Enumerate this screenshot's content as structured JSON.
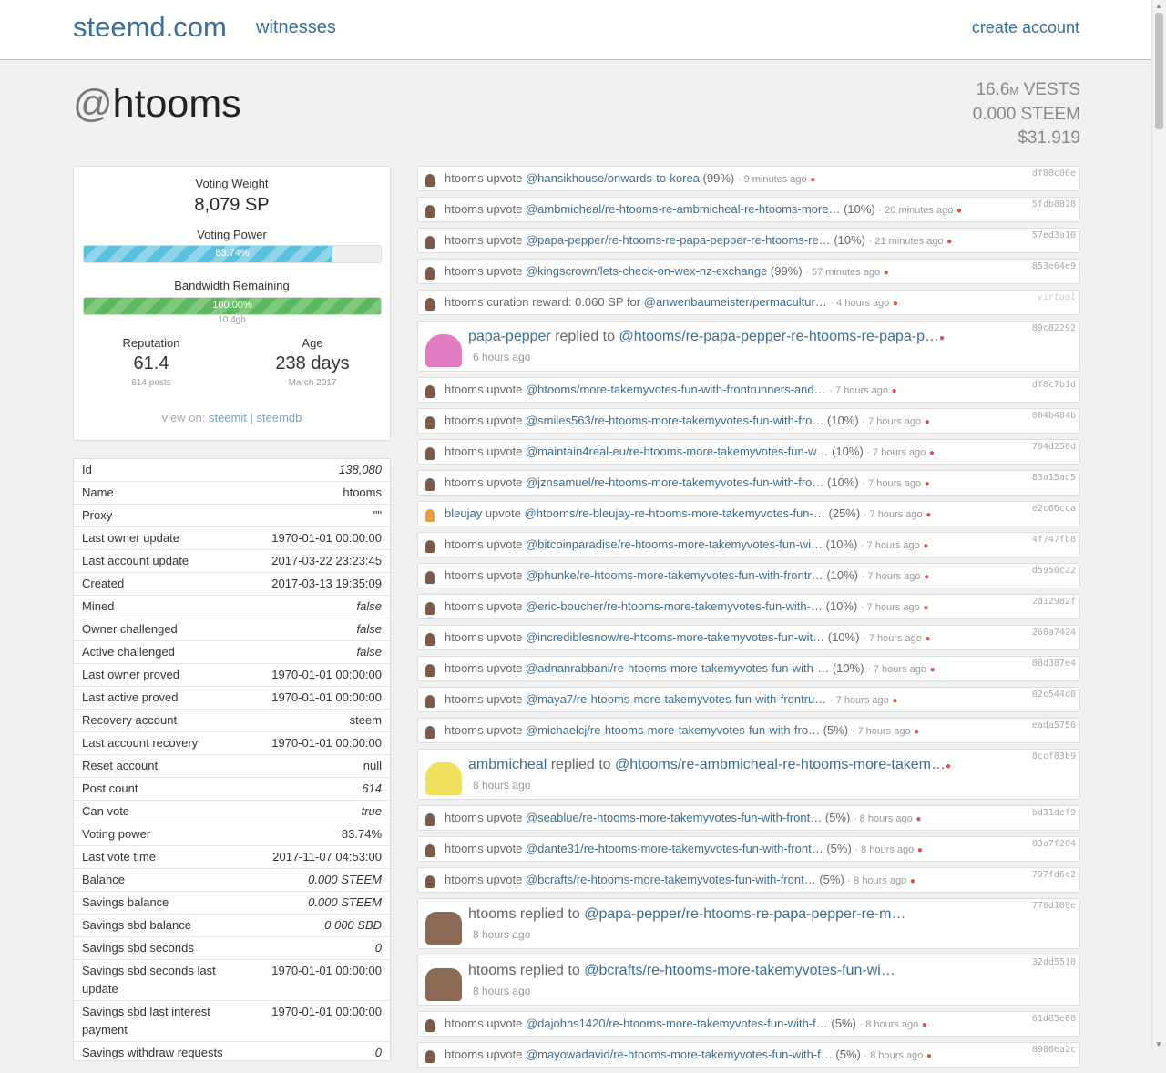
{
  "nav": {
    "brand": "steemd.com",
    "witnesses": "witnesses",
    "create": "create account"
  },
  "profile": {
    "at": "@",
    "name": "htooms"
  },
  "balances": {
    "vests_num": "16.6",
    "vests_unit": "M",
    "vests_label": " VESTS",
    "steem": "0.000 STEEM",
    "usd": "$31.919"
  },
  "stats": {
    "voting_weight_label": "Voting Weight",
    "voting_weight": "8,079 SP",
    "voting_power_label": "Voting Power",
    "voting_power_text": "83.74%",
    "voting_power_fraction": 0.8374,
    "bandwidth_label": "Bandwidth Remaining",
    "bandwidth_text": "100.00%",
    "bandwidth_fraction": 1.0,
    "bandwidth_size": "10.4gb",
    "reputation_label": "Reputation",
    "reputation": "61.4",
    "posts": "614 posts",
    "age_label": "Age",
    "age": "238 days",
    "age_since": "March 2017",
    "view_on": "view on:",
    "steemit": "steemit",
    "sep": "|",
    "steemdb": "steemdb"
  },
  "props": [
    {
      "k": "Id",
      "v": "138,080",
      "it": true
    },
    {
      "k": "Name",
      "v": "htooms",
      "it": false
    },
    {
      "k": "Proxy",
      "v": "\"\"",
      "it": false
    },
    {
      "k": "Last owner update",
      "v": "1970-01-01 00:00:00",
      "it": false
    },
    {
      "k": "Last account update",
      "v": "2017-03-22 23:23:45",
      "it": false
    },
    {
      "k": "Created",
      "v": "2017-03-13 19:35:09",
      "it": false
    },
    {
      "k": "Mined",
      "v": "false",
      "it": true
    },
    {
      "k": "Owner challenged",
      "v": "false",
      "it": true
    },
    {
      "k": "Active challenged",
      "v": "false",
      "it": true
    },
    {
      "k": "Last owner proved",
      "v": "1970-01-01 00:00:00",
      "it": false
    },
    {
      "k": "Last active proved",
      "v": "1970-01-01 00:00:00",
      "it": false
    },
    {
      "k": "Recovery account",
      "v": "steem",
      "it": false
    },
    {
      "k": "Last account recovery",
      "v": "1970-01-01 00:00:00",
      "it": false
    },
    {
      "k": "Reset account",
      "v": "null",
      "it": false
    },
    {
      "k": "Post count",
      "v": "614",
      "it": true
    },
    {
      "k": "Can vote",
      "v": "true",
      "it": true
    },
    {
      "k": "Voting power",
      "v": "83.74%",
      "it": false
    },
    {
      "k": "Last vote time",
      "v": "2017-11-07 04:53:00",
      "it": false
    },
    {
      "k": "Balance",
      "v": "0.000 STEEM",
      "it": true
    },
    {
      "k": "Savings balance",
      "v": "0.000 STEEM",
      "it": true
    },
    {
      "k": "Savings sbd balance",
      "v": "0.000 SBD",
      "it": true
    },
    {
      "k": "Savings sbd seconds",
      "v": "0",
      "it": true
    },
    {
      "k": "Savings sbd seconds last update",
      "v": "1970-01-01 00:00:00",
      "it": false
    },
    {
      "k": "Savings sbd last interest payment",
      "v": "1970-01-01 00:00:00",
      "it": false
    },
    {
      "k": "Savings withdraw requests",
      "v": "0",
      "it": true
    }
  ],
  "feed": [
    {
      "type": "vote",
      "user": "htooms",
      "verb": "upvote",
      "link": "@hansikhouse/onwards-to-korea",
      "pct": "(99%)",
      "ago": "· 9 minutes ago",
      "tx": "df80c06e"
    },
    {
      "type": "vote",
      "user": "htooms",
      "verb": "upvote",
      "link": "@ambmicheal/re-htooms-re-ambmicheal-re-htooms-more…",
      "pct": "(10%)",
      "ago": "· 20 minutes ago",
      "tx": "5fdb8828"
    },
    {
      "type": "vote",
      "user": "htooms",
      "verb": "upvote",
      "link": "@papa-pepper/re-htooms-re-papa-pepper-re-htooms-re…",
      "pct": "(10%)",
      "ago": "· 21 minutes ago",
      "tx": "57ed3a10"
    },
    {
      "type": "vote",
      "user": "htooms",
      "verb": "upvote",
      "link": "@kingscrown/lets-check-on-wex-nz-exchange",
      "pct": "(99%)",
      "ago": "· 57 minutes ago",
      "tx": "853e64e9"
    },
    {
      "type": "vote",
      "user": "htooms",
      "verb": "curation reward: 0.060 SP for",
      "link": "@anwenbaumeister/permacultur…",
      "pct": "",
      "ago": "· 4 hours ago",
      "tx": "virtual"
    },
    {
      "type": "reply",
      "user": "papa-pepper",
      "verb": "replied to",
      "link": "@htooms/re-papa-pepper-re-htooms-re-papa-p…",
      "ago": "6 hours ago",
      "tx": "89c82292",
      "avatar": "pink"
    },
    {
      "type": "vote",
      "user": "htooms",
      "verb": "upvote",
      "link": "@htooms/more-takemyvotes-fun-with-frontrunners-and…",
      "pct": "",
      "ago": "· 7 hours ago",
      "tx": "df8c7b1d"
    },
    {
      "type": "vote",
      "user": "htooms",
      "verb": "upvote",
      "link": "@smiles563/re-htooms-more-takemyvotes-fun-with-fro…",
      "pct": "(10%)",
      "ago": "· 7 hours ago",
      "tx": "004b484b"
    },
    {
      "type": "vote",
      "user": "htooms",
      "verb": "upvote",
      "link": "@maintain4real-eu/re-htooms-more-takemyvotes-fun-w…",
      "pct": "(10%)",
      "ago": "· 7 hours ago",
      "tx": "704d250d"
    },
    {
      "type": "vote",
      "user": "htooms",
      "verb": "upvote",
      "link": "@jznsamuel/re-htooms-more-takemyvotes-fun-with-fro…",
      "pct": "(10%)",
      "ago": "· 7 hours ago",
      "tx": "83a15ad5"
    },
    {
      "type": "vote",
      "user": "bleujay",
      "verb": "upvote",
      "link": "@htooms/re-bleujay-re-htooms-more-takemyvotes-fun-…",
      "pct": "(25%)",
      "ago": "· 7 hours ago",
      "tx": "e2c66cca",
      "userlink": true
    },
    {
      "type": "vote",
      "user": "htooms",
      "verb": "upvote",
      "link": "@bitcoinparadise/re-htooms-more-takemyvotes-fun-wi…",
      "pct": "(10%)",
      "ago": "· 7 hours ago",
      "tx": "4f747fb8"
    },
    {
      "type": "vote",
      "user": "htooms",
      "verb": "upvote",
      "link": "@phunke/re-htooms-more-takemyvotes-fun-with-frontr…",
      "pct": "(10%)",
      "ago": "· 7 hours ago",
      "tx": "d5950c22"
    },
    {
      "type": "vote",
      "user": "htooms",
      "verb": "upvote",
      "link": "@eric-boucher/re-htooms-more-takemyvotes-fun-with-…",
      "pct": "(10%)",
      "ago": "· 7 hours ago",
      "tx": "2d12982f"
    },
    {
      "type": "vote",
      "user": "htooms",
      "verb": "upvote",
      "link": "@incrediblesnow/re-htooms-more-takemyvotes-fun-wit…",
      "pct": "(10%)",
      "ago": "· 7 hours ago",
      "tx": "260a7424"
    },
    {
      "type": "vote",
      "user": "htooms",
      "verb": "upvote",
      "link": "@adnanrabbani/re-htooms-more-takemyvotes-fun-with-…",
      "pct": "(10%)",
      "ago": "· 7 hours ago",
      "tx": "88d387e4"
    },
    {
      "type": "vote",
      "user": "htooms",
      "verb": "upvote",
      "link": "@maya7/re-htooms-more-takemyvotes-fun-with-frontru…",
      "pct": "",
      "ago": "· 7 hours ago",
      "tx": "02c544d0"
    },
    {
      "type": "vote",
      "user": "htooms",
      "verb": "upvote",
      "link": "@michaelcj/re-htooms-more-takemyvotes-fun-with-fro…",
      "pct": "(5%)",
      "ago": "· 7 hours ago",
      "tx": "eada5756"
    },
    {
      "type": "reply",
      "user": "ambmicheal",
      "verb": "replied to",
      "link": "@htooms/re-ambmicheal-re-htooms-more-takem…",
      "ago": "8 hours ago",
      "tx": "8ccf83b9",
      "avatar": "yellow"
    },
    {
      "type": "vote",
      "user": "htooms",
      "verb": "upvote",
      "link": "@seablue/re-htooms-more-takemyvotes-fun-with-front…",
      "pct": "(5%)",
      "ago": "· 8 hours ago",
      "tx": "bd31def9"
    },
    {
      "type": "vote",
      "user": "htooms",
      "verb": "upvote",
      "link": "@dante31/re-htooms-more-takemyvotes-fun-with-front…",
      "pct": "(5%)",
      "ago": "· 8 hours ago",
      "tx": "03a7f204"
    },
    {
      "type": "vote",
      "user": "htooms",
      "verb": "upvote",
      "link": "@bcrafts/re-htooms-more-takemyvotes-fun-with-front…",
      "pct": "(5%)",
      "ago": "· 8 hours ago",
      "tx": "797fd6c2"
    },
    {
      "type": "reply",
      "user": "htooms",
      "verb": "replied to",
      "link": "@papa-pepper/re-htooms-re-papa-pepper-re-m…",
      "ago": "8 hours ago",
      "tx": "778d108e",
      "avatar": "brown",
      "muted": true
    },
    {
      "type": "reply",
      "user": "htooms",
      "verb": "replied to",
      "link": "@bcrafts/re-htooms-more-takemyvotes-fun-wi…",
      "ago": "8 hours ago",
      "tx": "32dd5510",
      "avatar": "brown",
      "muted": true
    },
    {
      "type": "vote",
      "user": "htooms",
      "verb": "upvote",
      "link": "@dajohns1420/re-htooms-more-takemyvotes-fun-with-f…",
      "pct": "(5%)",
      "ago": "· 8 hours ago",
      "tx": "61d85e08"
    },
    {
      "type": "vote",
      "user": "htooms",
      "verb": "upvote",
      "link": "@mayowadavid/re-htooms-more-takemyvotes-fun-with-f…",
      "pct": "(5%)",
      "ago": "· 8 hours ago",
      "tx": "8986ea2c"
    }
  ]
}
